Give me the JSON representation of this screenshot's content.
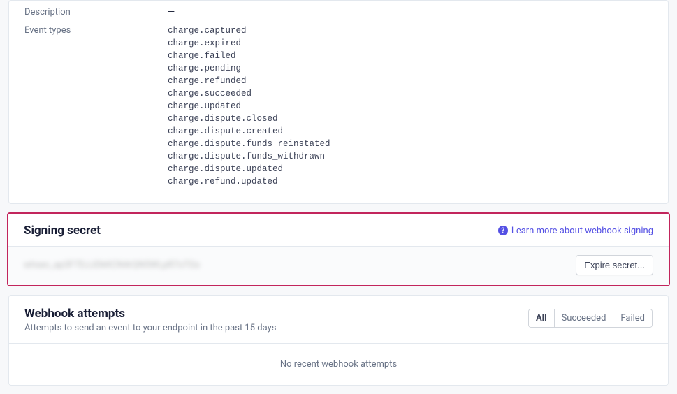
{
  "info": {
    "description_label": "Description",
    "description_value": "—",
    "event_types_label": "Event types",
    "event_types": [
      "charge.captured",
      "charge.expired",
      "charge.failed",
      "charge.pending",
      "charge.refunded",
      "charge.succeeded",
      "charge.updated",
      "charge.dispute.closed",
      "charge.dispute.created",
      "charge.dispute.funds_reinstated",
      "charge.dispute.funds_withdrawn",
      "charge.dispute.updated",
      "charge.refund.updated"
    ]
  },
  "signing": {
    "title": "Signing secret",
    "learn_more": "Learn more about webhook signing",
    "secret_blurred": "whsec_ap3F7DJJDkKCN4rQN5WLpR7oTGs",
    "expire_label": "Expire secret..."
  },
  "attempts": {
    "title": "Webhook attempts",
    "subtitle": "Attempts to send an event to your endpoint in the past 15 days",
    "filters": {
      "all": "All",
      "succeeded": "Succeeded",
      "failed": "Failed"
    },
    "empty": "No recent webhook attempts"
  }
}
